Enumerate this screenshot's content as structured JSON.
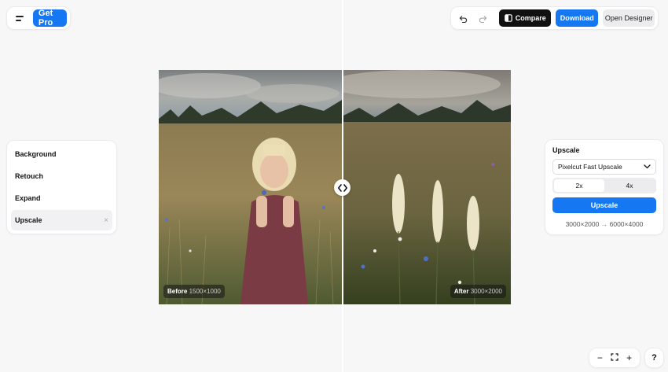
{
  "toolbar": {
    "get_pro_label": "Get Pro",
    "compare_label": "Compare",
    "download_label": "Download",
    "open_designer_label": "Open Designer"
  },
  "sidebar": {
    "items": [
      {
        "label": "Background"
      },
      {
        "label": "Retouch"
      },
      {
        "label": "Expand"
      },
      {
        "label": "Upscale",
        "active": true
      }
    ]
  },
  "upscale_panel": {
    "title": "Upscale",
    "model_selected": "Pixelcut Fast Upscale",
    "scale_options": [
      "2x",
      "4x"
    ],
    "scale_selected": "2x",
    "action_label": "Upscale",
    "source_resolution": "3000×2000",
    "target_resolution": "6000×4000"
  },
  "canvas": {
    "before_label": "Before",
    "before_resolution": "1500×1000",
    "after_label": "After",
    "after_resolution": "3000×2000"
  },
  "zoom": {
    "out_label": "−",
    "in_label": "+"
  },
  "help_label": "?",
  "colors": {
    "accent": "#1677f2",
    "compare_bg": "#111111"
  }
}
